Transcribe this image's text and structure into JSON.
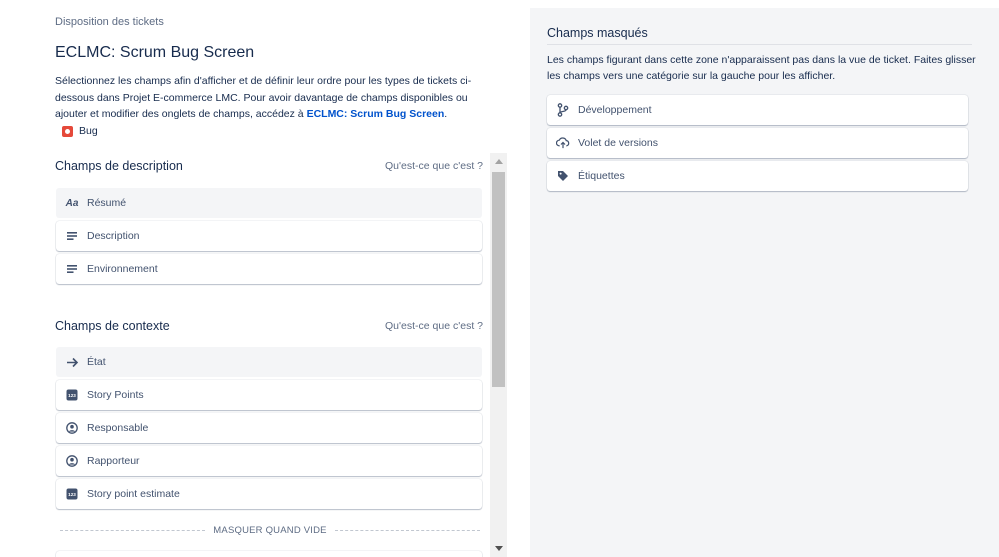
{
  "breadcrumb": "Disposition des tickets",
  "title": "ECLMC: Scrum Bug Screen",
  "description": {
    "text": "Sélectionnez les champs afin d'afficher et de définir leur ordre pour les types de tickets ci-dessous dans Projet E-commerce LMC. Pour avoir davantage de champs disponibles ou ajouter et modifier des onglets de champs, accédez à ",
    "link": "ECLMC: Scrum Bug Screen",
    "end": "."
  },
  "issue_type": {
    "label": "Bug",
    "color": "#e5493a"
  },
  "description_fields": {
    "title": "Champs de description",
    "help": "Qu'est-ce que c'est ?",
    "items": [
      {
        "label": "Résumé",
        "icon": "text-aa-icon"
      },
      {
        "label": "Description",
        "icon": "paragraph-icon"
      },
      {
        "label": "Environnement",
        "icon": "paragraph-icon"
      }
    ]
  },
  "context_fields": {
    "title": "Champs de contexte",
    "help": "Qu'est-ce que c'est ?",
    "items": [
      {
        "label": "État",
        "icon": "arrow-right-icon"
      },
      {
        "label": "Story Points",
        "icon": "number-icon"
      },
      {
        "label": "Responsable",
        "icon": "user-avatar-icon"
      },
      {
        "label": "Rapporteur",
        "icon": "user-avatar-icon"
      },
      {
        "label": "Story point estimate",
        "icon": "number-icon"
      }
    ],
    "divider": "MASQUER QUAND VIDE"
  },
  "hidden_fields": {
    "title": "Champs masqués",
    "description": "Les champs figurant dans cette zone n'apparaissent pas dans la vue de ticket. Faites glisser les champs vers une catégorie sur la gauche pour les afficher.",
    "items": [
      {
        "label": "Développement",
        "icon": "branch-icon"
      },
      {
        "label": "Volet de versions",
        "icon": "cloud-upload-icon"
      },
      {
        "label": "Étiquettes",
        "icon": "tag-icon"
      }
    ]
  },
  "colors": {
    "link": "#0052cc",
    "text": "#172b4d",
    "panel": "#f4f5f7"
  }
}
